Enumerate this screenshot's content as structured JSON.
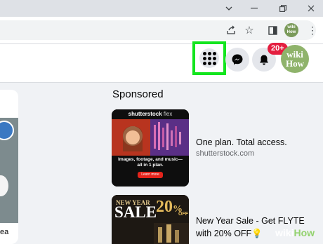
{
  "browser": {
    "window_controls": [
      "chevron-down-icon",
      "minimize-icon",
      "restore-icon",
      "close-icon"
    ],
    "toolbar_icons": [
      "share-icon",
      "bookmark-star-icon",
      "side-panel-icon",
      "more-vert-icon"
    ],
    "profile_avatar": "wiki How"
  },
  "facebook_bar": {
    "menu_icon": "grid-menu-icon",
    "messenger_icon": "messenger-icon",
    "notifications_icon": "bell-icon",
    "notification_badge": "20+",
    "avatar": {
      "line1": "wiki",
      "line2": "How"
    },
    "highlight_color": "#13e51e"
  },
  "left_card": {
    "text": "ea"
  },
  "sponsored": {
    "heading": "Sponsored",
    "ads": [
      {
        "title": "One plan. Total access.",
        "url": "shutterstock.com",
        "image": {
          "brand": "shutterstock",
          "tag": "flex",
          "caption": "Images, footage, and music—all in 1 plan.",
          "button": "Learn more"
        }
      },
      {
        "title_line1": "New Year Sale - Get FLYTE",
        "title_line2": "with 20% OFF",
        "image": {
          "line1": "NEW YEAR",
          "line2": "SALE",
          "discount": "20",
          "pct": "%",
          "off": "OFF"
        }
      }
    ]
  },
  "watermark": {
    "wiki": "wiki",
    "how": "How"
  }
}
